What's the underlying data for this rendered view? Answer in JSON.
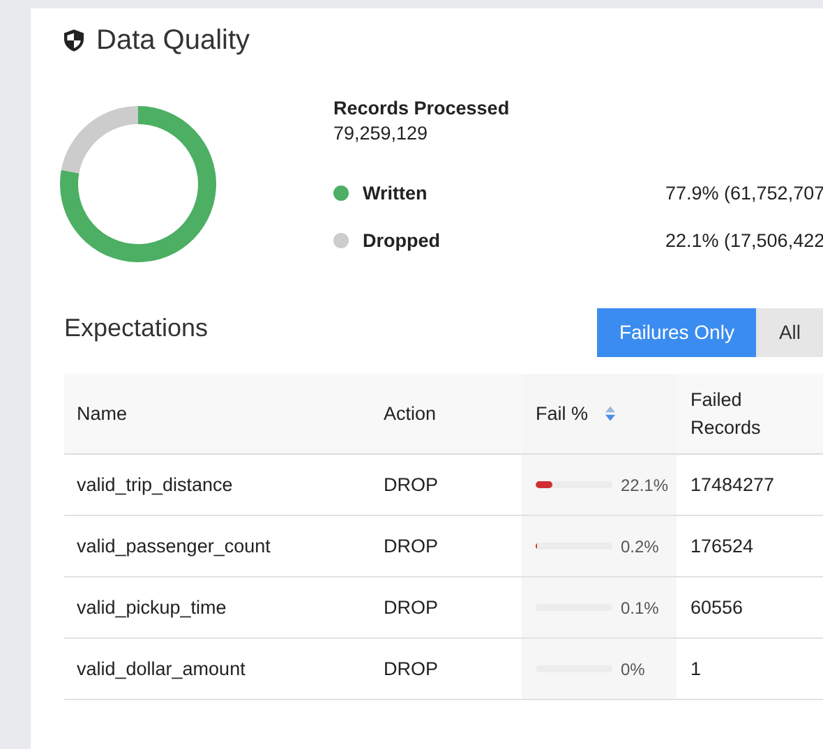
{
  "panel": {
    "title": "Data Quality"
  },
  "summary": {
    "label": "Records Processed",
    "total": "79,259,129",
    "chart_data": {
      "type": "donut",
      "categories": [
        "Written",
        "Dropped"
      ],
      "values": [
        77.9,
        22.1
      ]
    },
    "legend": [
      {
        "color": "#4caf63",
        "value": "77.9% (61,752,707"
      },
      {
        "color": "#cccccc",
        "value": "22.1% (17,506,422"
      }
    ]
  },
  "expectations": {
    "title": "Expectations",
    "filters": [
      {
        "label": "Failures Only",
        "selected": true
      },
      {
        "label": "All",
        "selected": false
      }
    ],
    "columns": [
      "Name",
      "Action",
      "Fail %",
      "Failed Records"
    ],
    "rows": [
      {
        "name": "valid_trip_distance",
        "action": "DROP",
        "level": 0.221,
        "fail_pct": "22.1%",
        "failed": "17484277"
      },
      {
        "name": "valid_passenger_count",
        "action": "DROP",
        "level": 0.002,
        "fail_pct": "0.2%",
        "failed": "176524"
      },
      {
        "name": "valid_pickup_time",
        "action": "DROP",
        "level": 0.001,
        "fail_pct": "0.1%",
        "failed": "60556"
      },
      {
        "name": "valid_dollar_amount",
        "action": "DROP",
        "fail_pct": "0%",
        "failed": "1"
      }
    ]
  }
}
